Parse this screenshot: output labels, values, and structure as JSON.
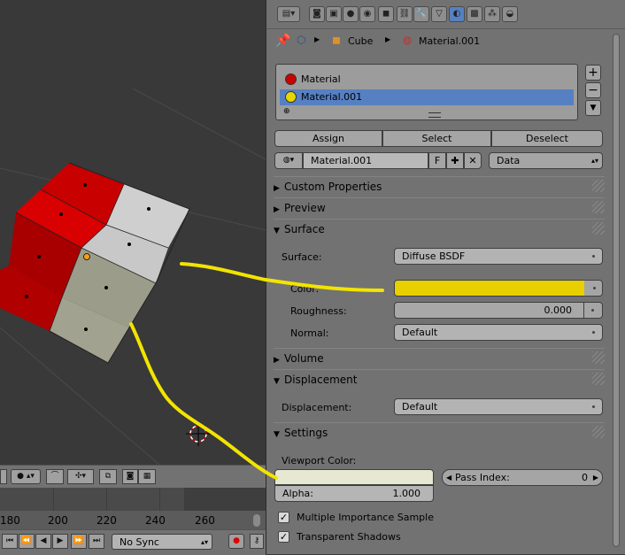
{
  "timeline": {
    "ticks": [
      "180",
      "200",
      "220",
      "240",
      "260"
    ],
    "sync_mode": "No Sync"
  },
  "breadcrumb": {
    "object": "Cube",
    "material": "Material.001"
  },
  "material_slots": [
    {
      "name": "Material",
      "color": "#cc0000"
    },
    {
      "name": "Material.001",
      "color": "#e8d600",
      "selected": true
    }
  ],
  "slot_actions": {
    "assign": "Assign",
    "select": "Select",
    "deselect": "Deselect"
  },
  "datablock": {
    "name": "Material.001",
    "fake_user": "F",
    "link": "Data"
  },
  "sections": {
    "custom_properties": "Custom Properties",
    "preview": "Preview",
    "surface": "Surface",
    "volume": "Volume",
    "displacement": "Displacement",
    "settings": "Settings"
  },
  "surface": {
    "surface_label": "Surface:",
    "surface_value": "Diffuse BSDF",
    "color_label": "Color:",
    "color_value": "#e8cf00",
    "roughness_label": "Roughness:",
    "roughness_value": "0.000",
    "normal_label": "Normal:",
    "normal_value": "Default"
  },
  "displacement": {
    "label": "Displacement:",
    "value": "Default"
  },
  "settings": {
    "viewport_color_label": "Viewport Color:",
    "viewport_color": "#e6e8d2",
    "alpha_label": "Alpha:",
    "alpha_value": "1.000",
    "pass_index_label": "Pass Index:",
    "pass_index_value": "0",
    "mis_label": "Multiple Importance Sample",
    "mis_checked": true,
    "transparent_shadows_label": "Transparent Shadows",
    "transparent_shadows_checked": true
  },
  "colors": {
    "selection": "#5680c2",
    "annotation": "#f2e400",
    "cube_red": "#c80000",
    "cube_white": "#d0d0d0"
  }
}
